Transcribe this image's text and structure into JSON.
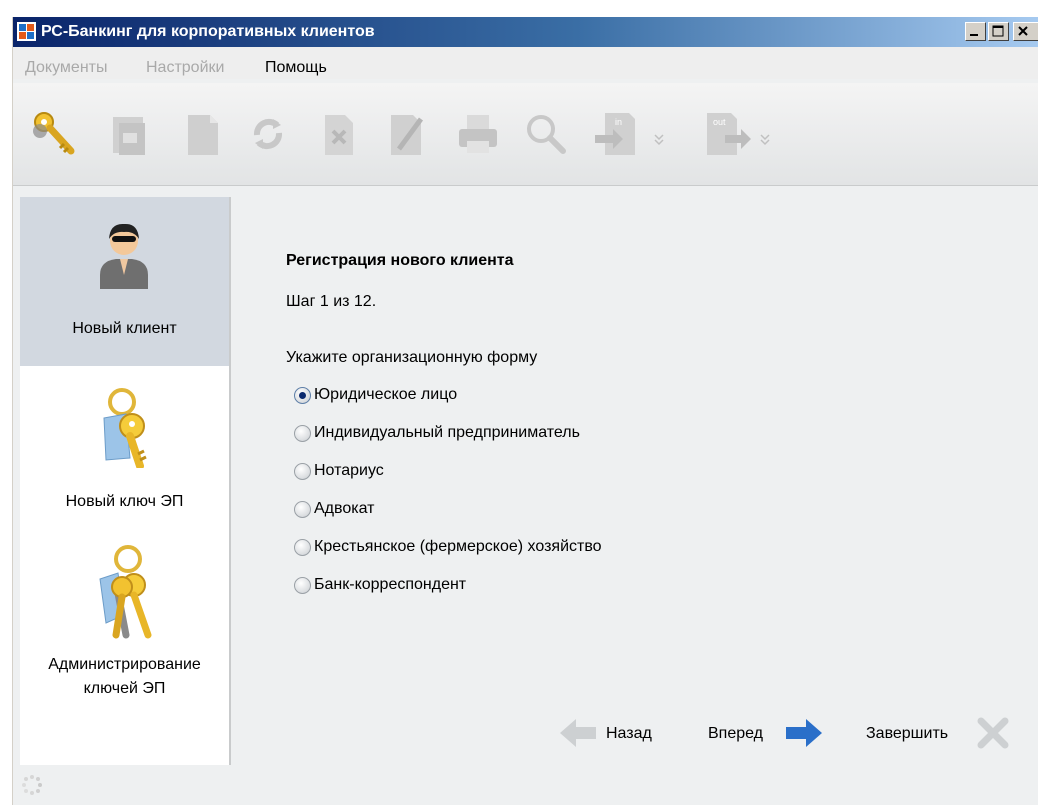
{
  "window": {
    "title": "РС-Банкинг для корпоративных клиентов"
  },
  "menu": {
    "items": [
      "Документы",
      "Настройки",
      "Помощь"
    ]
  },
  "toolbar": {
    "icons": [
      "keys-icon",
      "copy-document-icon",
      "new-document-icon",
      "refresh-icon",
      "delete-document-icon",
      "edit-document-icon",
      "print-icon",
      "search-icon",
      "import-in-icon",
      "export-out-icon"
    ],
    "import_text": "in",
    "export_text": "out"
  },
  "sidebar": {
    "items": [
      {
        "label": "Новый клиент",
        "selected": true
      },
      {
        "label": "Новый ключ ЭП",
        "selected": false
      },
      {
        "label_line1": "Администрирование",
        "label_line2": "ключей ЭП",
        "selected": false
      }
    ]
  },
  "wizard": {
    "title": "Регистрация нового клиента",
    "step": "Шаг 1 из 12.",
    "prompt": "Укажите организационную форму",
    "options": [
      {
        "label": "Юридическое лицо",
        "selected": true
      },
      {
        "label": "Индивидуальный предприниматель",
        "selected": false
      },
      {
        "label": "Нотариус",
        "selected": false
      },
      {
        "label": "Адвокат",
        "selected": false
      },
      {
        "label": "Крестьянское (фермерское) хозяйство",
        "selected": false
      },
      {
        "label": "Банк-корреспондент",
        "selected": false
      }
    ],
    "buttons": {
      "back": "Назад",
      "forward": "Вперед",
      "finish": "Завершить"
    }
  },
  "colors": {
    "titlebar_start": "#0a246a",
    "accent_blue": "#2a6fc9",
    "selection": "#d2d8e0"
  }
}
